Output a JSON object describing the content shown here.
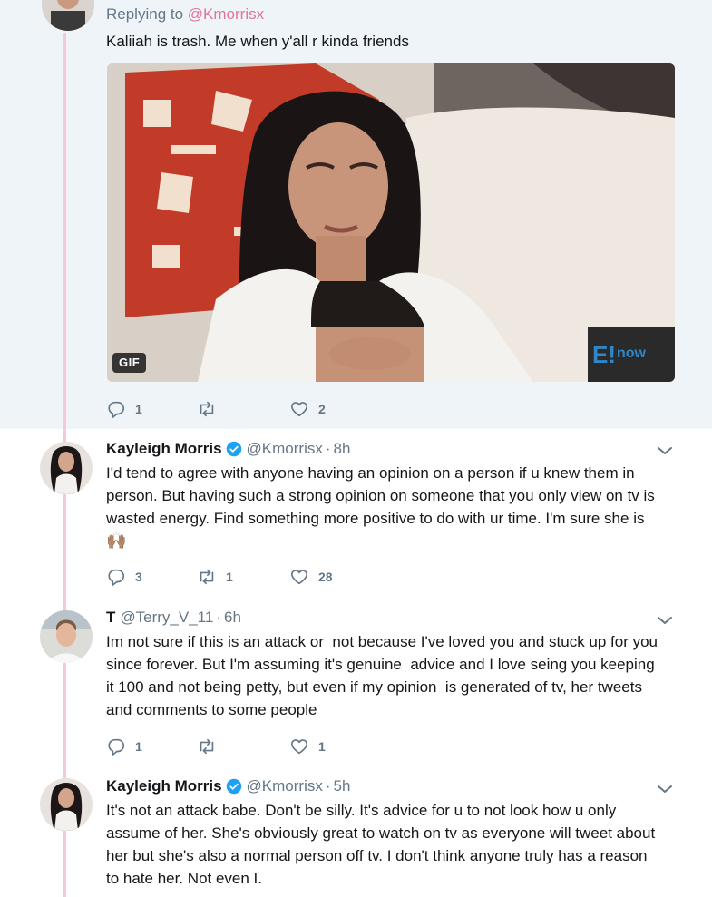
{
  "top_tweet": {
    "reply_prefix": "Replying to ",
    "reply_handle": "@Kmorrisx",
    "text": "Kaliiah is trash. Me when y'all r kinda friends",
    "media_badge": "GIF",
    "watermark": "now",
    "actions": {
      "replies": "1",
      "retweets": "",
      "likes": "2"
    }
  },
  "replies": [
    {
      "name": "Kayleigh Morris",
      "verified": true,
      "handle": "@Kmorrisx",
      "time": "8h",
      "lines": [
        "I'd tend to agree with anyone having an opinion on a person if u knew them in",
        "person. But having such a strong opinion on someone that you only view on tv is",
        "wasted energy. Find something more positive to do with ur time. I'm sure she is",
        "🙌🏽"
      ],
      "actions": {
        "replies": "3",
        "retweets": "1",
        "likes": "28"
      }
    },
    {
      "name": "T",
      "verified": false,
      "handle": "@Terry_V_11",
      "time": "6h",
      "lines": [
        "Im not sure if this is an attack or  not because I've loved you and stuck up for you",
        "since forever. But I'm assuming it's genuine  advice and I love seing you keeping",
        "it 100 and not being petty, but even if my opinion  is generated of tv, her tweets",
        "and comments to some people"
      ],
      "actions": {
        "replies": "1",
        "retweets": "",
        "likes": "1"
      }
    },
    {
      "name": "Kayleigh Morris",
      "verified": true,
      "handle": "@Kmorrisx",
      "time": "5h",
      "lines": [
        "It's not an attack babe. Don't be silly. It's advice for u to not look how u only",
        "assume of her. She's obviously great to watch on tv as everyone will tweet about",
        "her but she's also a normal person off tv. I don't think anyone truly has a reason",
        "to hate her. Not even I."
      ]
    }
  ],
  "separator": "·",
  "colors": {
    "thread_line": "#f6c9d8",
    "muted": "#657786",
    "verified": "#1da1f2",
    "link": "#e0759a",
    "highlight_bg": "#eef4f8"
  }
}
